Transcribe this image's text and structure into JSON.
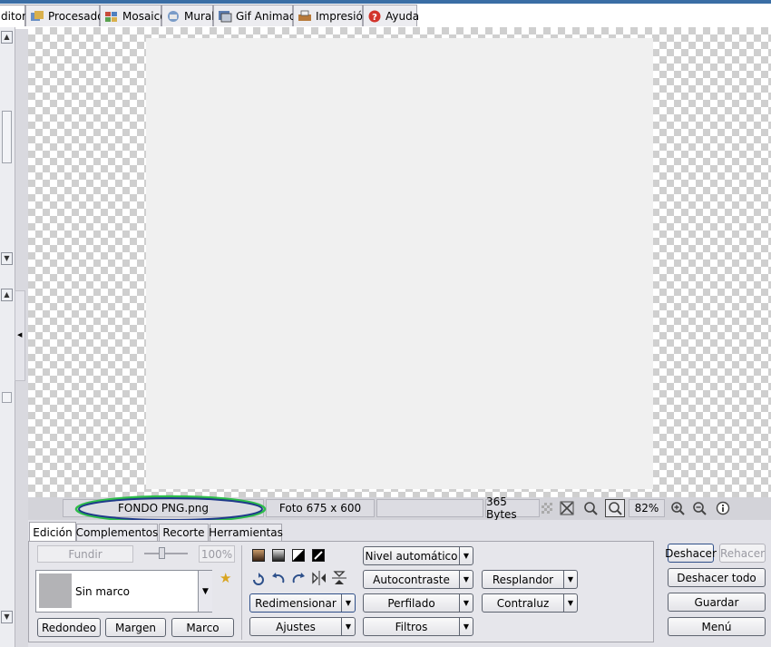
{
  "tabs": [
    {
      "label": "ditor",
      "icon": "editor-icon"
    },
    {
      "label": "Procesador",
      "icon": "processor-icon"
    },
    {
      "label": "Mosaico",
      "icon": "mosaic-icon"
    },
    {
      "label": "Mural",
      "icon": "mural-icon"
    },
    {
      "label": "Gif Animado",
      "icon": "gif-icon"
    },
    {
      "label": "Impresión",
      "icon": "print-icon"
    },
    {
      "label": "Ayuda",
      "icon": "help-icon"
    }
  ],
  "status": {
    "filename": "FONDO PNG.png",
    "dimensions": "Foto 675 x 600",
    "size": "365 Bytes",
    "zoom": "82%"
  },
  "panel_tabs": [
    "Edición",
    "Complementos",
    "Recorte",
    "Herramientas"
  ],
  "edicion": {
    "fundir": "Fundir",
    "opacity": "100%",
    "frame_option": "Sin marco",
    "redondeo": "Redondeo",
    "margen": "Margen",
    "marco": "Marco",
    "redimensionar": "Redimensionar",
    "ajustes": "Ajustes",
    "nivel_automatico": "Nivel automático",
    "autocontraste": "Autocontraste",
    "perfilado": "Perfilado",
    "filtros": "Filtros",
    "resplandor": "Resplandor",
    "contraluz": "Contraluz"
  },
  "actions": {
    "deshacer": "Deshacer",
    "rehacer": "Rehacer",
    "deshacer_todo": "Deshacer todo",
    "guardar": "Guardar",
    "menu": "Menú"
  },
  "colors": {
    "accent": "#3a6ea5",
    "highlight_ellipse_outer": "#1f3a8a",
    "highlight_ellipse_inner": "#2ebd4a",
    "checker": "#cfcfcf"
  }
}
